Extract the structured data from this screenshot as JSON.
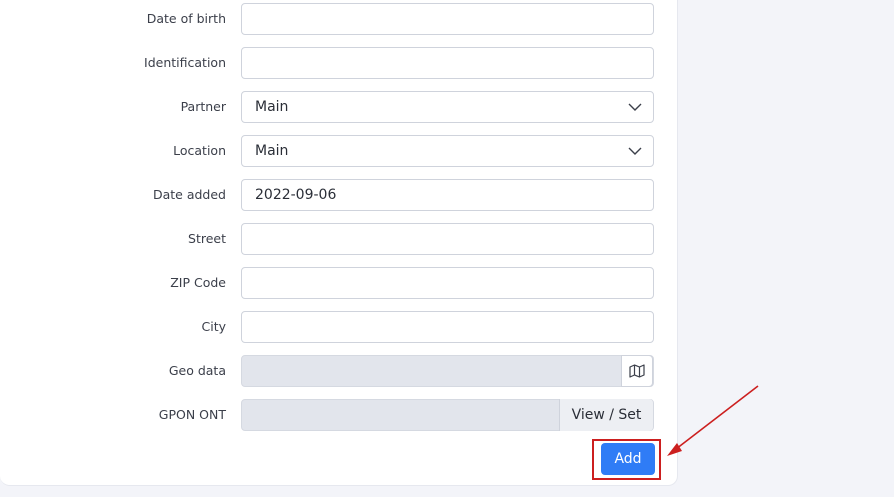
{
  "form": {
    "fields": [
      {
        "label": "Date of birth",
        "value": ""
      },
      {
        "label": "Identification",
        "value": ""
      },
      {
        "label": "Partner",
        "value": "Main"
      },
      {
        "label": "Location",
        "value": "Main"
      },
      {
        "label": "Date added",
        "value": "2022-09-06"
      },
      {
        "label": "Street",
        "value": ""
      },
      {
        "label": "ZIP Code",
        "value": ""
      },
      {
        "label": "City",
        "value": ""
      },
      {
        "label": "Geo data",
        "value": ""
      },
      {
        "label": "GPON ONT",
        "value": ""
      }
    ],
    "gpon_button_label": "View / Set",
    "add_label": "Add"
  },
  "icons": {
    "select_chevron": "chevron-down-icon",
    "geo_map": "map-icon"
  },
  "colors": {
    "primary": "#2f7cf6",
    "annotation": "#cc1f1f",
    "disabled_field": "#e2e5ec"
  }
}
